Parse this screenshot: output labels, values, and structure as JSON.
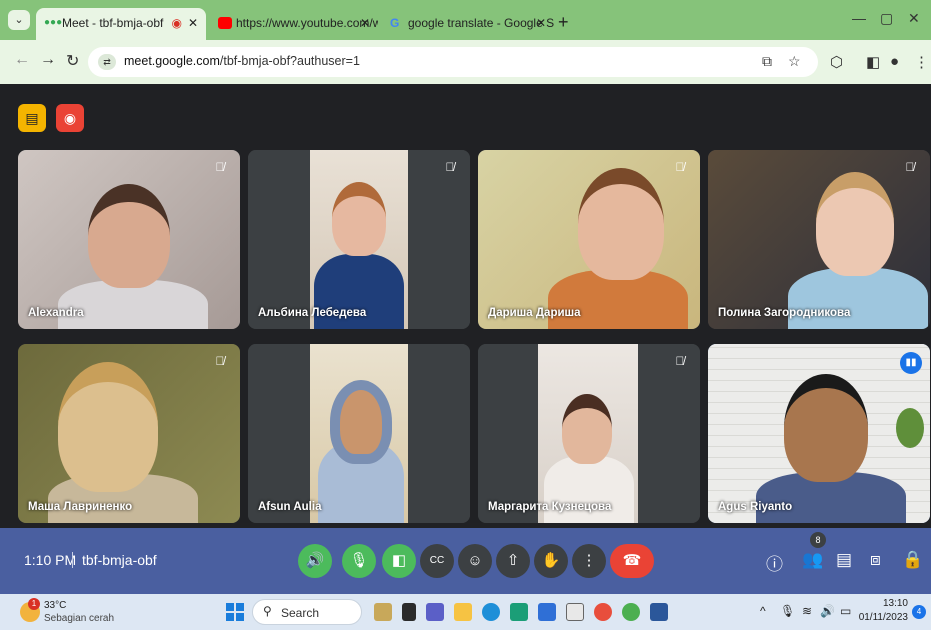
{
  "browser": {
    "tabs": [
      {
        "label": "Meet - tbf-bmja-obf",
        "active": true
      },
      {
        "label": "https://www.youtube.com/wat",
        "active": false
      },
      {
        "label": "google translate - Google Sear",
        "active": false
      }
    ],
    "url_host": "meet.google.com",
    "url_path": "/tbf-bmja-obf?authuser=1"
  },
  "meet": {
    "participants": [
      {
        "name": "Alexandra",
        "muted": true
      },
      {
        "name": "Альбина Лебедева",
        "muted": true
      },
      {
        "name": "Дариша Дариша",
        "muted": true
      },
      {
        "name": "Полина Загородникова",
        "muted": true
      },
      {
        "name": "Маша Лавриненко",
        "muted": true
      },
      {
        "name": "Afsun Aulia",
        "muted": false
      },
      {
        "name": "Маргарита Кузнецова",
        "muted": true
      },
      {
        "name": "Agus Riyanto",
        "muted": false,
        "speaking": true
      }
    ],
    "time": "1:10 PM",
    "meeting_code": "tbf-bmja-obf",
    "people_count": "8"
  },
  "taskbar": {
    "temperature": "33°C",
    "weather": "Sebagian cerah",
    "weather_alert": "1",
    "search_label": "Search",
    "time": "13:10",
    "date": "01/11/2023",
    "notifications": "4"
  },
  "colors": {
    "chrome_frame": "#86c37a",
    "meet_bg": "#202124",
    "bottom_bar": "#4a5fa0",
    "mic_green": "#4cbb5c",
    "leave_red": "#ea4335"
  }
}
